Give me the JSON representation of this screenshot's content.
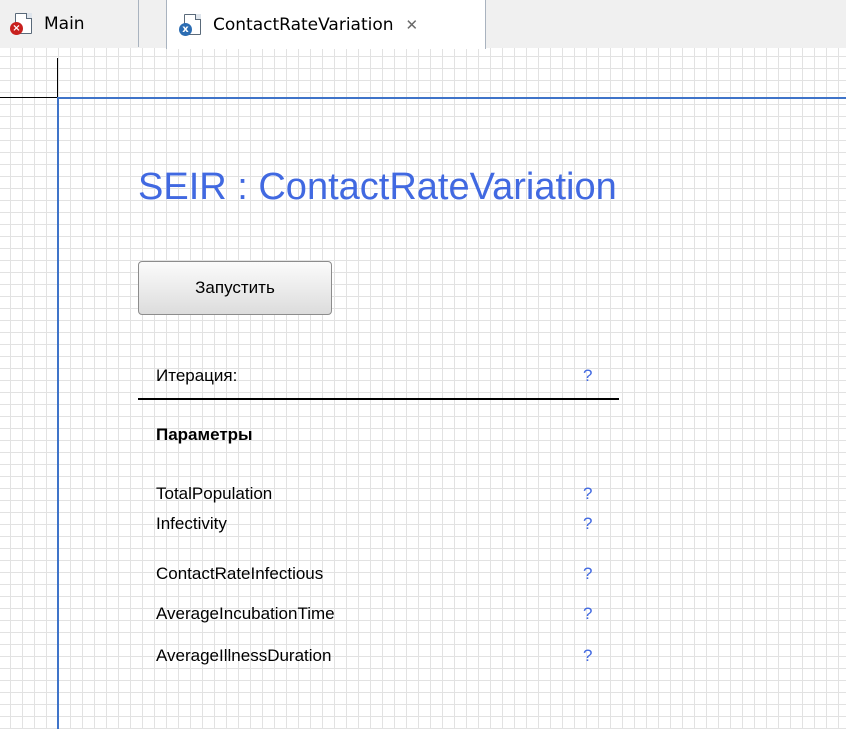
{
  "tabs": [
    {
      "label": "Main",
      "icon": "model-lock-icon",
      "active": false
    },
    {
      "label": "ContactRateVariation",
      "icon": "experiment-doc-icon",
      "active": true
    }
  ],
  "experiment": {
    "title": "SEIR : ContactRateVariation",
    "run_button_label": "Запустить",
    "iteration": {
      "label": "Итерация:",
      "value": "?"
    },
    "parameters_heading": "Параметры",
    "parameters": [
      {
        "name": "TotalPopulation",
        "value": "?"
      },
      {
        "name": "Infectivity",
        "value": "?"
      },
      {
        "name": "ContactRateInfectious",
        "value": "?"
      },
      {
        "name": "AverageIncubationTime",
        "value": "?"
      },
      {
        "name": "AverageIllnessDuration",
        "value": "?"
      }
    ]
  },
  "colors": {
    "title": "#4169e1",
    "frame": "#3f74c9",
    "grid": "#e2e2e2"
  }
}
